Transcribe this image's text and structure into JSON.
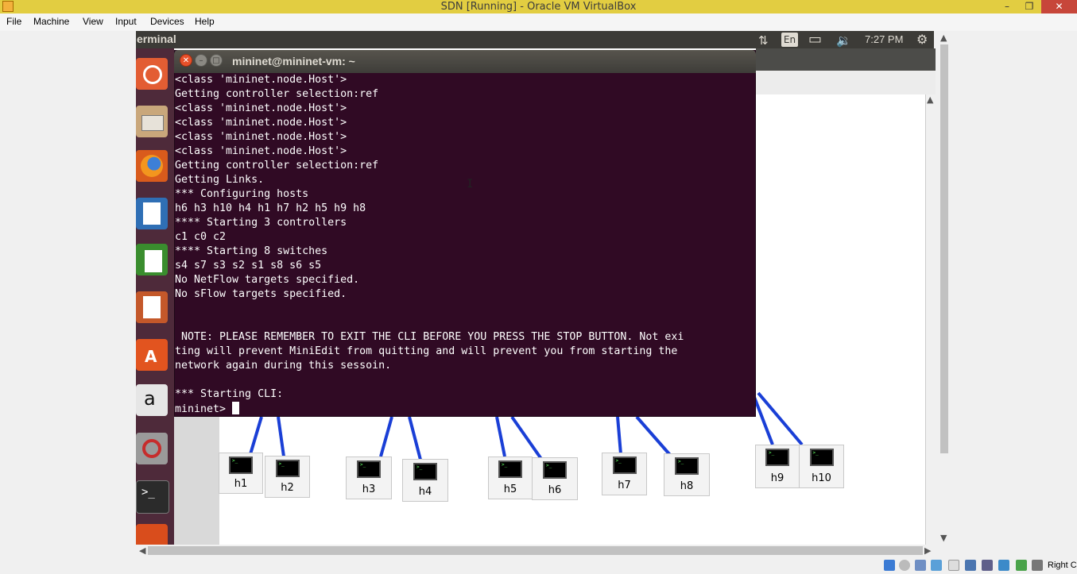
{
  "window": {
    "title": "SDN [Running] - Oracle VM VirtualBox",
    "minimize": "–",
    "maximize": "❐",
    "close": "✕"
  },
  "menu": [
    "File",
    "Machine",
    "View",
    "Input",
    "Devices",
    "Help"
  ],
  "guest_panel": {
    "title": "erminal",
    "lang": "En",
    "time": "7:27 PM",
    "network_icon": "⇅",
    "battery_icon": "▭",
    "volume_icon": "🔉",
    "gear_icon": "⚙"
  },
  "terminal": {
    "title": "mininet@mininet-vm: ~",
    "close": "✕",
    "minimize": "–",
    "maximize": "□",
    "lines": [
      "<class 'mininet.node.Host'>",
      "Getting controller selection:ref",
      "<class 'mininet.node.Host'>",
      "<class 'mininet.node.Host'>",
      "<class 'mininet.node.Host'>",
      "<class 'mininet.node.Host'>",
      "Getting controller selection:ref",
      "Getting Links.",
      "*** Configuring hosts",
      "h6 h3 h10 h4 h1 h7 h2 h5 h9 h8",
      "**** Starting 3 controllers",
      "c1 c0 c2",
      "**** Starting 8 switches",
      "s4 s7 s3 s2 s1 s8 s6 s5",
      "No NetFlow targets specified.",
      "No sFlow targets specified.",
      "",
      "",
      " NOTE: PLEASE REMEMBER TO EXIT THE CLI BEFORE YOU PRESS THE STOP BUTTON. Not exi",
      "ting will prevent MiniEdit from quitting and will prevent you from starting the",
      "network again during this sessoin.",
      "",
      "*** Starting CLI:"
    ],
    "prompt": "mininet> "
  },
  "hosts": [
    "h1",
    "h2",
    "h3",
    "h4",
    "h5",
    "h6",
    "h7",
    "h8",
    "h9",
    "h10"
  ],
  "statusbar": {
    "host_key": "Right C"
  },
  "colors": {
    "titlebar": "#e2cd41",
    "terminal_bg": "#300a24",
    "launcher_bg": "#4e2a3a",
    "link": "#1a3fd6"
  }
}
